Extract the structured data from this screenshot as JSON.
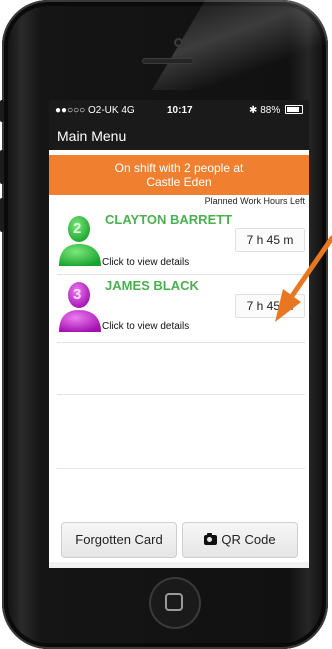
{
  "status_bar": {
    "carrier": "●●○○○ O2-UK  4G",
    "time": "10:17",
    "battery": "✱ 88%"
  },
  "nav": {
    "title": "Main Menu"
  },
  "banner": {
    "line1": "On shift with 2 people at",
    "line2": "Castle Eden"
  },
  "hours_header": "Planned Work Hours Left",
  "people": [
    {
      "badge": "2",
      "name": "CLAYTON BARRETT",
      "name_color": "#4caf50",
      "hours": "7 h 45 m",
      "link": "Click to view details",
      "avatar_color": "#22c44a"
    },
    {
      "badge": "3",
      "name": "JAMES BLACK",
      "name_color": "#4caf50",
      "hours": "7 h 45 m",
      "link": "Click to view details",
      "avatar_color": "#c21ad0"
    }
  ],
  "buttons": {
    "forgotten_card": "Forgotten Card",
    "qr_code": "QR Code"
  },
  "colors": {
    "accent": "#f08030",
    "arrow": "#e87722"
  }
}
